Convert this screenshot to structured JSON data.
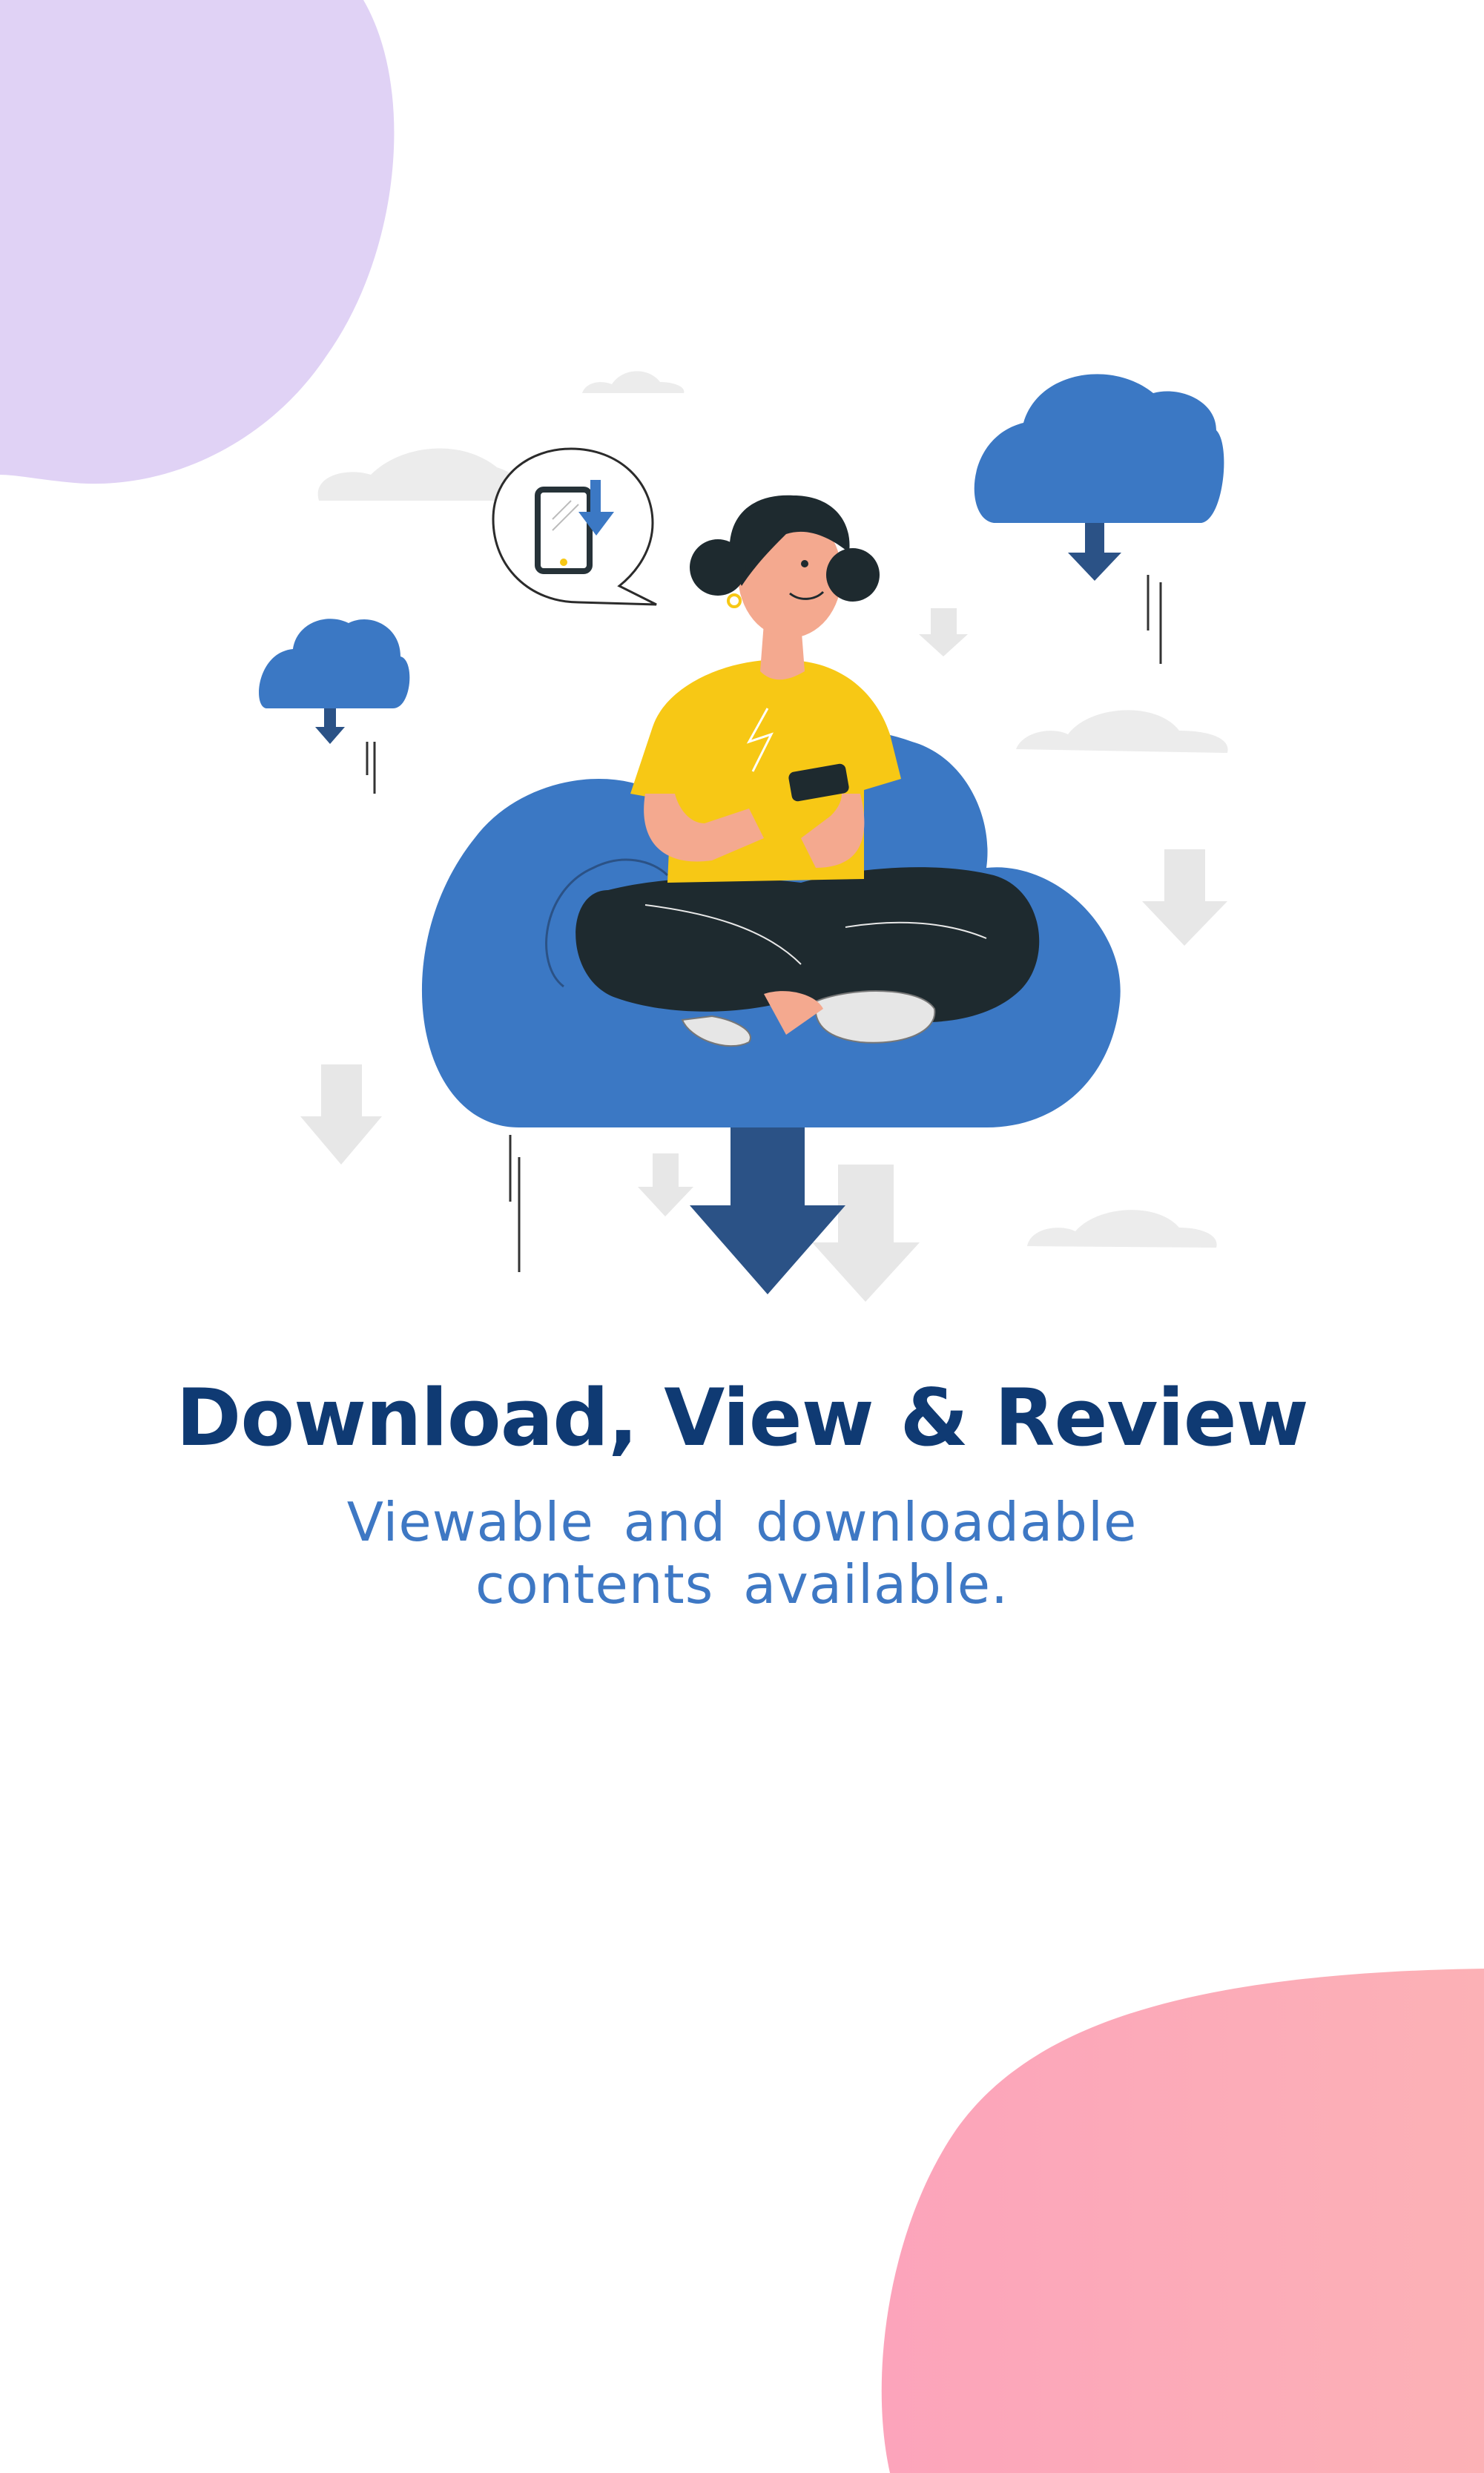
{
  "screen": {
    "headline": "Download, View & Review",
    "subtitle_line_1": "Viewable  and  downloadable",
    "subtitle_line_2": "contents  available."
  },
  "illustration": {
    "subject": "woman sitting cross-legged on a cloud using a phone",
    "icons": [
      "cloud-download-icon",
      "tablet-download-icon",
      "arrow-down-icon"
    ]
  },
  "colors": {
    "headline": "#0f3a73",
    "subtitle": "#3e78c4",
    "cloud_blue": "#3b78c4",
    "arrow_dark_blue": "#2b5286",
    "shirt_yellow": "#f7c815",
    "blob_purple": "#e0d2f5",
    "blob_pink": "#fcabb7"
  }
}
